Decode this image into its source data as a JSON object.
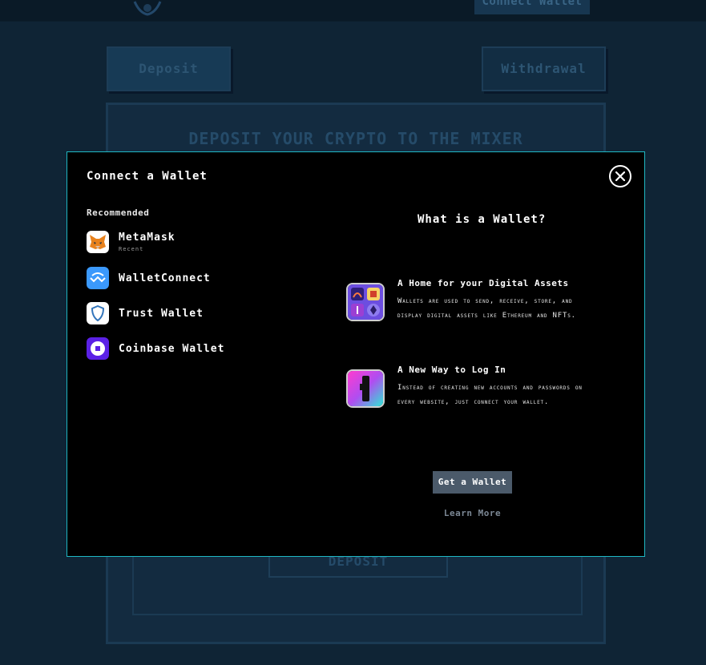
{
  "header": {
    "connect_label": "Connect Wallet"
  },
  "tabs": {
    "deposit_label": "Deposit",
    "withdrawal_label": "Withdrawal"
  },
  "panel": {
    "title": "DEPOSIT YOUR CRYPTO TO THE MIXER",
    "deposit_button": "DEPOSIT"
  },
  "modal": {
    "title": "Connect a Wallet",
    "section_label": "Recommended",
    "wallets": [
      {
        "name": "MetaMask",
        "sub": "Recent",
        "icon": "metamask-fox-icon"
      },
      {
        "name": "WalletConnect",
        "sub": "",
        "icon": "walletconnect-icon"
      },
      {
        "name": "Trust Wallet",
        "sub": "",
        "icon": "trust-shield-icon"
      },
      {
        "name": "Coinbase Wallet",
        "sub": "",
        "icon": "coinbase-icon"
      }
    ],
    "info": {
      "title": "What is a Wallet?",
      "blocks": [
        {
          "heading": "A Home for your Digital Assets",
          "desc": "Wallets are used to send, receive, store, and display digital assets like Ethereum and NFTs."
        },
        {
          "heading": "A New Way to Log In",
          "desc": "Instead of creating new accounts and passwords on every website, just connect your wallet."
        }
      ],
      "get_wallet_label": "Get a Wallet",
      "learn_more_label": "Learn More"
    }
  },
  "colors": {
    "accent_border": "#1fb8c4",
    "background": "#0f2435",
    "button": "#4b5a6a"
  }
}
